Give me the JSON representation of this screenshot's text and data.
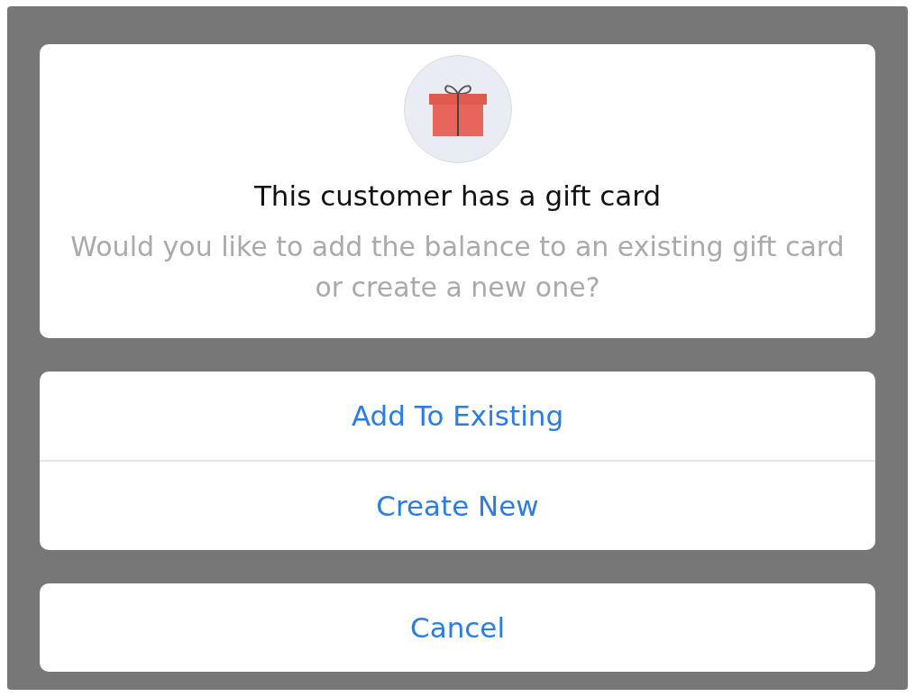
{
  "alert": {
    "title": "This customer has a gift card",
    "message": "Would you like to add the balance to an existing gift card or create a new one?"
  },
  "actions": [
    "Add To Existing",
    "Create New"
  ],
  "cancel": "Cancel"
}
